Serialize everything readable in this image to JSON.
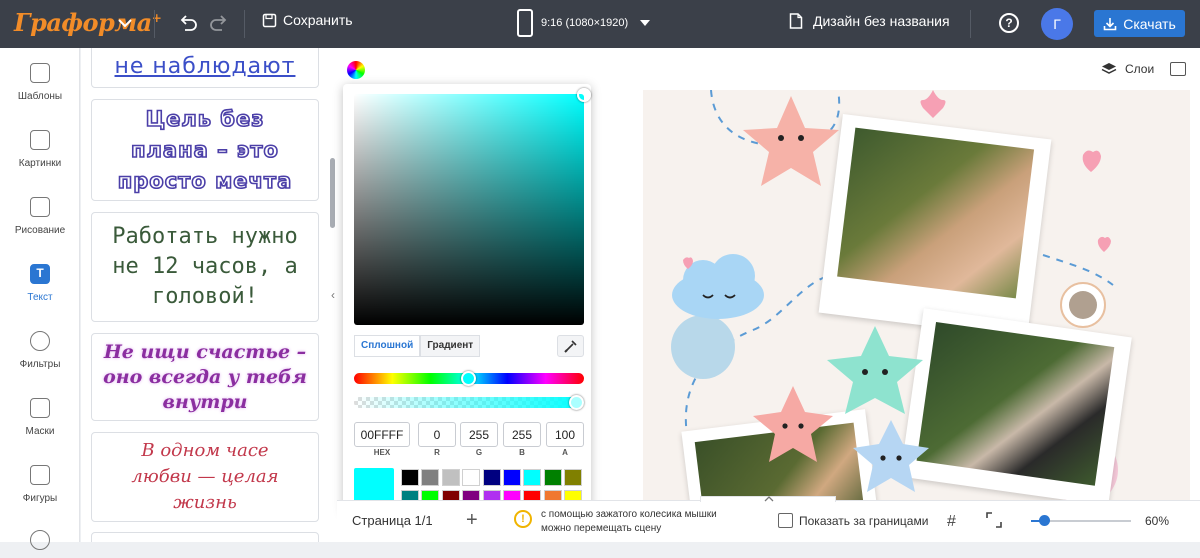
{
  "topbar": {
    "logo": "Граформа",
    "logo_plus": "+",
    "save_label": "Сохранить",
    "size_label": "9:16 (1080×1920)",
    "design_name": "Дизайн без названия",
    "help": "?",
    "avatar_letter": "Г",
    "download_label": "Скачать"
  },
  "leftnav": {
    "items": [
      {
        "label": "Шаблоны",
        "icon": "templates-icon"
      },
      {
        "label": "Картинки",
        "icon": "images-icon"
      },
      {
        "label": "Рисование",
        "icon": "pencil-icon"
      },
      {
        "label": "Текст",
        "icon": "text-icon",
        "glyph": "T"
      },
      {
        "label": "Фильтры",
        "icon": "filters-icon"
      },
      {
        "label": "Маски",
        "icon": "masks-icon"
      },
      {
        "label": "Фигуры",
        "icon": "shapes-icon"
      }
    ]
  },
  "textpanel": {
    "cards": [
      "не наблюдают",
      "Цель без плана – это просто мечта",
      "Работать нужно не 12 часов, а головой!",
      "Не ищи счастье – оно всегда у тебя внутри",
      "В одном часе любви — целая жизнь"
    ]
  },
  "canvas": {
    "layers_label": "Слои"
  },
  "picker": {
    "tabs": [
      "Сплошной",
      "Градиент"
    ],
    "active_tab": "Сплошной",
    "fields": [
      {
        "label": "HEX",
        "value": "00FFFF"
      },
      {
        "label": "R",
        "value": "0"
      },
      {
        "label": "G",
        "value": "255"
      },
      {
        "label": "B",
        "value": "255"
      },
      {
        "label": "A",
        "value": "100"
      }
    ],
    "current_color": "#00ffff",
    "swatches": [
      "#000000",
      "#808080",
      "#c0c0c0",
      "#ffffff",
      "#000080",
      "#0000ff",
      "#00ffff",
      "#008000",
      "#808000",
      "#008080",
      "#00ff00",
      "#800000",
      "#800080",
      "#b030f0",
      "#ff00ff",
      "#ff0000",
      "#f07830",
      "#ffff00"
    ]
  },
  "bottombar": {
    "page_label": "Страница 1/1",
    "add_page": "+",
    "hint_line1": "с помощью зажатого колесика мышки",
    "hint_line2": "можно перемещать сцену",
    "show_outside_label": "Показать за границами",
    "zoom_value": "60%",
    "zoom_level": 0.6
  },
  "colors": {
    "accent": "#2a76d2",
    "topbar": "#3b4049",
    "logo": "#f28c28"
  }
}
